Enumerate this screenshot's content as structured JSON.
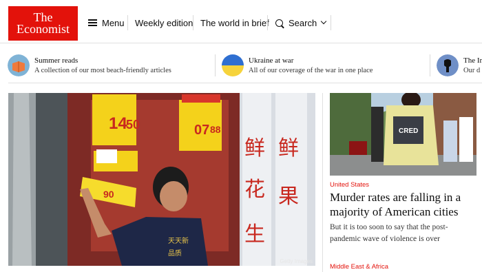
{
  "header": {
    "logo_line1": "The",
    "logo_line2": "Economist",
    "nav": {
      "menu_label": "Menu",
      "weekly_label": "Weekly edition",
      "brief_label": "The world in brief",
      "search_label": "Search"
    }
  },
  "topics": [
    {
      "title": "Summer reads",
      "subtitle": "A collection of our most beach-friendly articles",
      "icon": "book-icon"
    },
    {
      "title": "Ukraine at war",
      "subtitle": "All of our coverage of the war in one place",
      "icon": "ukraine-flag-icon"
    },
    {
      "title": "The In",
      "subtitle": "Our d",
      "icon": "inner-icon"
    }
  ],
  "hero": {
    "price1": "14",
    "price1b": "50",
    "price2": "07",
    "price2b": "88",
    "price3": "90",
    "credit": "Getty Images"
  },
  "story": {
    "section": "United States",
    "headline": "Murder rates are falling in a majority of American cities",
    "subheading": "But it is too soon to say that the post-pandemic wave of violence is over",
    "image_text": "CRED"
  },
  "next_section": "Middle East & Africa",
  "colors": {
    "brand": "#e3120b"
  }
}
